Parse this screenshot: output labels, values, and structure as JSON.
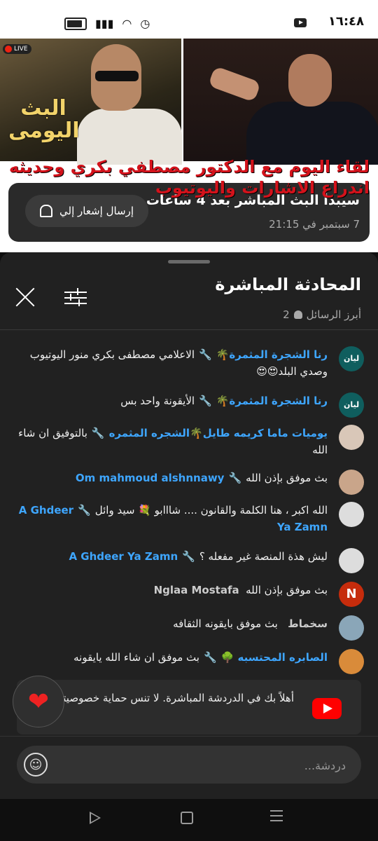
{
  "status": {
    "time": "١٦:٤٨"
  },
  "video": {
    "live_badge": "LIVE",
    "show_logo": "البث اليومى",
    "overlay_title": "لقاء اليوم مع الدكتور مصطفي بكري وحديثه اندراع الاشارات واليوتيوب"
  },
  "notify": {
    "main": "سيبدأ البث المباشر بعد 4 ساعات",
    "sub": "7 سبتمبر في 21:15",
    "button": "إرسال إشعار إلي"
  },
  "chat": {
    "title": "المحادثة المباشرة",
    "subtitle": "أبرز الرسائل",
    "viewers": "2",
    "messages": [
      {
        "author": "رنا الشجرة المثمرة🌴",
        "text": "الاعلامي مصطفى بكري منور اليوتيوب وصدي البلد😍😍",
        "avatar": "ليان",
        "avatar_color": "#0f5e5e"
      },
      {
        "author": "رنا الشجرة المثمرة🌴",
        "text": "الأيقونة واحد بس",
        "avatar": "ليان",
        "avatar_color": "#0f5e5e"
      },
      {
        "author": "يوميات ماما كريمه طايل🌴الشجره المثمره",
        "text": "بالتوفيق ان شاء الله",
        "avatar": "",
        "avatar_color": "#d9c7b8"
      },
      {
        "author": "Om mahmoud alshnnawy",
        "text": "بث موفق بإذن الله",
        "avatar": "",
        "avatar_color": "#c9a58a"
      },
      {
        "author": "A Ghdeer Ya Zamn",
        "text": "الله اكبر ، هنا الكلمة والقانون .... شااابو 💐 سيد وائل",
        "avatar": "",
        "avatar_color": "#ddd"
      },
      {
        "author": "A Ghdeer Ya Zamn",
        "text": "ليش هذة المنصة غير مفعله ؟",
        "avatar": "",
        "avatar_color": "#ddd"
      },
      {
        "author": "Nglaa Mostafa",
        "text": "بث موفق بإذن الله",
        "avatar": "N",
        "avatar_color": "#c62c0c"
      },
      {
        "author": "سخماط",
        "text": "بث موفق بايقونه الثقافه",
        "avatar": "",
        "avatar_color": "#8aa6b8"
      },
      {
        "author": "الصابره المحتسبه 🌳",
        "text": "بث موفق ان شاء الله يايقونه",
        "avatar": "",
        "avatar_color": "#d98b3a"
      }
    ],
    "welcome": "أهلاً بك في الدردشة المباشرة. لا تنس حماية خصوصيتك والالتزام بإرشادات المنتدى.",
    "input_placeholder": "دردشة..."
  },
  "colors": {
    "accent": "#3ea6ff",
    "brand": "#ff0000",
    "panel": "#212121"
  }
}
